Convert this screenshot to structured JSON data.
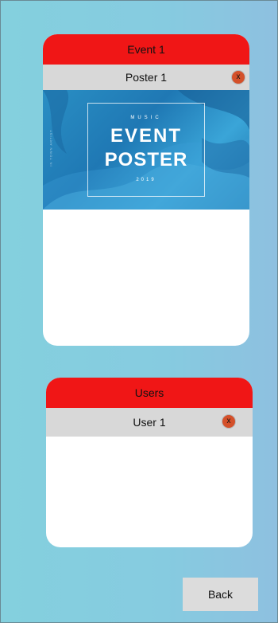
{
  "events": {
    "title": "Event 1",
    "posters": [
      {
        "name": "Poster 1",
        "remove_label": "x",
        "image": {
          "subtitle": "MUSIC",
          "line1": "EVENT",
          "line2": "POSTER",
          "year": "2019",
          "side_text": "IN TOWN ARTIST"
        }
      }
    ]
  },
  "users": {
    "title": "Users",
    "items": [
      {
        "name": "User 1",
        "remove_label": "x"
      }
    ]
  },
  "back_label": "Back",
  "colors": {
    "header_red": "#f01616",
    "remove_orange": "#d4502a",
    "bar_gray": "#d8d8d8"
  }
}
